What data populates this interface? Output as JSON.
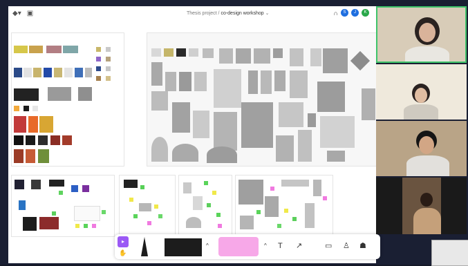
{
  "board": {
    "project_label": "Thesis project",
    "separator": "/",
    "board_name": "co-design workshop",
    "chevron": "⌄"
  },
  "topbar_icons": {
    "menu": "menu-icon",
    "layout": "layout-icon",
    "headset": "headset-icon"
  },
  "avatars": [
    {
      "initial": "S",
      "color": "#1f6fe0"
    },
    {
      "initial": "J",
      "color": "#1f6fe0"
    },
    {
      "initial": "K",
      "color": "#2aa84a"
    }
  ],
  "toolbar": {
    "select_icon": "cursor-icon",
    "hand_icon": "hand-icon",
    "text_tool": "T",
    "connector_tool": "↗",
    "frame_icon": "frame-icon",
    "stamp_icon": "stamp-icon",
    "shapes_icon": "shapes-icon",
    "sticky_color": "#f7a8e8",
    "marker_color": "#1c1c1c",
    "accent": "#9b59f5"
  },
  "participants": [
    "participant-1",
    "participant-2",
    "participant-3",
    "participant-4"
  ],
  "colors": {
    "background": "#1a1f33",
    "board": "#ffffff",
    "video_border_active": "#3ec46a"
  }
}
